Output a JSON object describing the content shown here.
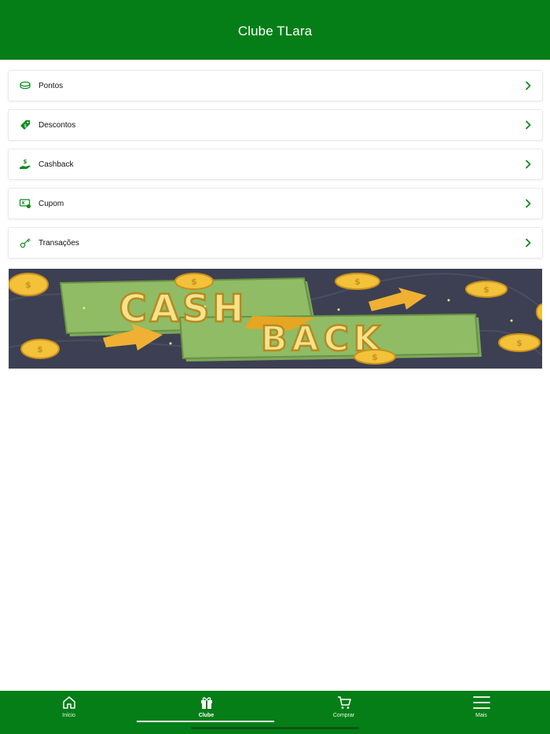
{
  "header": {
    "title": "Clube TLara"
  },
  "menu": {
    "items": [
      {
        "label": "Pontos",
        "icon": "coins-icon"
      },
      {
        "label": "Descontos",
        "icon": "discount-tag-icon"
      },
      {
        "label": "Cashback",
        "icon": "cashback-hand-icon"
      },
      {
        "label": "Cupom",
        "icon": "coupon-icon"
      },
      {
        "label": "Transações",
        "icon": "key-icon"
      }
    ]
  },
  "banner": {
    "line1": "CASH",
    "line2": "BACK"
  },
  "tabbar": {
    "tabs": [
      {
        "label": "Início",
        "icon": "home-icon"
      },
      {
        "label": "Clube",
        "icon": "gift-icon",
        "active": true
      },
      {
        "label": "Comprar",
        "icon": "cart-icon"
      },
      {
        "label": "Mais",
        "icon": "menu-icon"
      }
    ]
  },
  "colors": {
    "brand": "#057e17",
    "accent": "#0a8a1c"
  }
}
